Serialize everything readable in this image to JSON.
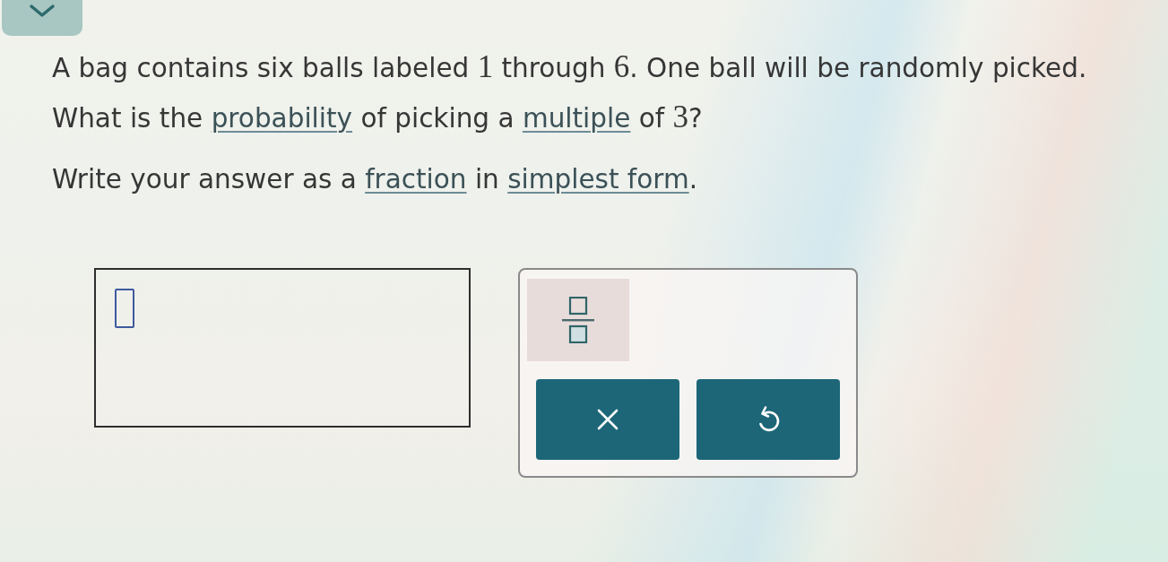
{
  "question": {
    "paragraphs": [
      {
        "lines": [
          [
            {
              "kind": "text",
              "text": "A bag contains six balls labeled "
            },
            {
              "kind": "math",
              "text": "1"
            },
            {
              "kind": "text",
              "text": " through "
            },
            {
              "kind": "math",
              "text": "6"
            },
            {
              "kind": "text",
              "text": ". One ball will be randomly picked."
            }
          ],
          [
            {
              "kind": "text",
              "text": "What is the "
            },
            {
              "kind": "link",
              "text": "probability"
            },
            {
              "kind": "text",
              "text": " of picking a "
            },
            {
              "kind": "link",
              "text": "multiple"
            },
            {
              "kind": "text",
              "text": " of "
            },
            {
              "kind": "math",
              "text": "3"
            },
            {
              "kind": "text",
              "text": "?"
            }
          ]
        ]
      },
      {
        "lines": [
          [
            {
              "kind": "text",
              "text": "Write your answer as a "
            },
            {
              "kind": "link",
              "text": "fraction"
            },
            {
              "kind": "text",
              "text": " in "
            },
            {
              "kind": "link",
              "text": "simplest form"
            },
            {
              "kind": "text",
              "text": "."
            }
          ]
        ]
      }
    ]
  },
  "palette": {
    "tools": [
      {
        "kind": "fraction"
      }
    ],
    "buttons": [
      {
        "kind": "clear"
      },
      {
        "kind": "undo"
      }
    ]
  }
}
